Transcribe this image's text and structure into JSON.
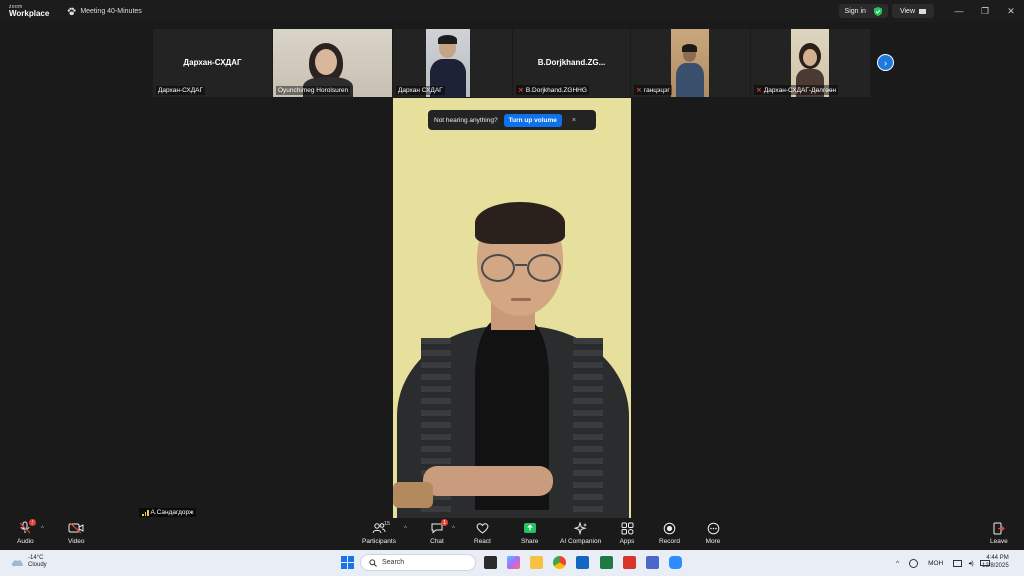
{
  "window": {
    "logo_top": "zoom",
    "logo_bottom": "Workplace",
    "meeting_title": "Meeting 40-Minutes",
    "sign_in": "Sign in",
    "view": "View",
    "controls": {
      "minimize": "—",
      "restore": "❐",
      "close": "✕"
    }
  },
  "thumbnails": [
    {
      "name": "Дархан-СХДАГ",
      "big_label": "Дархан-СХДАГ",
      "muted": false,
      "video": false
    },
    {
      "name": "Oyunchimeg Horolsuren",
      "muted": false,
      "video": true
    },
    {
      "name": "Дархан СХДАГ",
      "muted": false,
      "video": true
    },
    {
      "name": "B.Dorjkhand.ZGHHG",
      "big_label": "B.Dorjkhand.ZG...",
      "muted": true,
      "video": false
    },
    {
      "name": "ганцэцэг",
      "muted": true,
      "video": true
    },
    {
      "name": "Дархан-СХДАГ-Дөлгөөн",
      "muted": true,
      "video": true
    }
  ],
  "notice": {
    "text": "Not hearing anything?",
    "button": "Turn up volume",
    "close": "×"
  },
  "self_view": {
    "name": "А.Сандагдорж"
  },
  "toolbar": {
    "audio": "Audio",
    "video": "Video",
    "participants": "Participants",
    "participants_count": "15",
    "chat": "Chat",
    "chat_badge": "1",
    "react": "React",
    "share": "Share",
    "ai_companion": "AI Companion",
    "apps": "Apps",
    "record": "Record",
    "more": "More",
    "leave": "Leave"
  },
  "taskbar": {
    "temperature": "-14°C",
    "condition": "Cloudy",
    "search_placeholder": "Search",
    "language": "МОН",
    "time": "4:44 PM",
    "date": "12/8/2025"
  },
  "colors": {
    "accent": "#0e72ed",
    "share_green": "#22c55e",
    "muted_red": "#e0463a",
    "speaker_wall": "#e7e09c"
  }
}
